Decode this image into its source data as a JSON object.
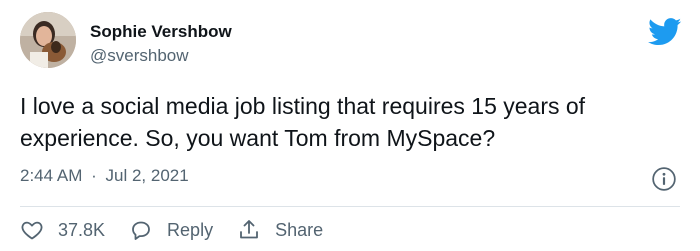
{
  "author": {
    "display_name": "Sophie Vershbow",
    "handle": "@svershbow"
  },
  "tweet": {
    "text": "I love a social media job listing that requires 15 years of\nexperience. So, you want Tom from MySpace?",
    "time": "2:44 AM",
    "separator": "·",
    "date": "Jul 2, 2021"
  },
  "actions": {
    "like_count": "37.8K",
    "reply_label": "Reply",
    "share_label": "Share"
  },
  "colors": {
    "brand": "#1d9bf0",
    "text_primary": "#0f1419",
    "text_secondary": "#536471",
    "divider": "#dde3e8"
  },
  "icons": [
    "twitter-bird-icon",
    "info-icon",
    "heart-icon",
    "reply-icon",
    "share-icon"
  ]
}
